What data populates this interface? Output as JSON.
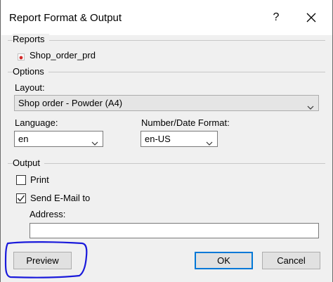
{
  "window": {
    "title": "Report Format & Output",
    "help": "?"
  },
  "reports": {
    "group_label": "Reports",
    "items": [
      {
        "label": "Shop_order_prd",
        "icon": "report-icon"
      }
    ]
  },
  "options": {
    "group_label": "Options",
    "layout_label": "Layout:",
    "layout_value": "Shop order - Powder (A4)",
    "language_label": "Language:",
    "language_value": "en",
    "format_label": "Number/Date Format:",
    "format_value": "en-US"
  },
  "output": {
    "group_label": "Output",
    "print_label": "Print",
    "print_checked": false,
    "email_label": "Send E-Mail to",
    "email_checked": true,
    "address_label": "Address:",
    "address_value": ""
  },
  "buttons": {
    "preview": "Preview",
    "ok": "OK",
    "cancel": "Cancel"
  },
  "colors": {
    "accent": "#0078d7",
    "annotation": "#1a1adb",
    "icon_red": "#d22a2a"
  }
}
